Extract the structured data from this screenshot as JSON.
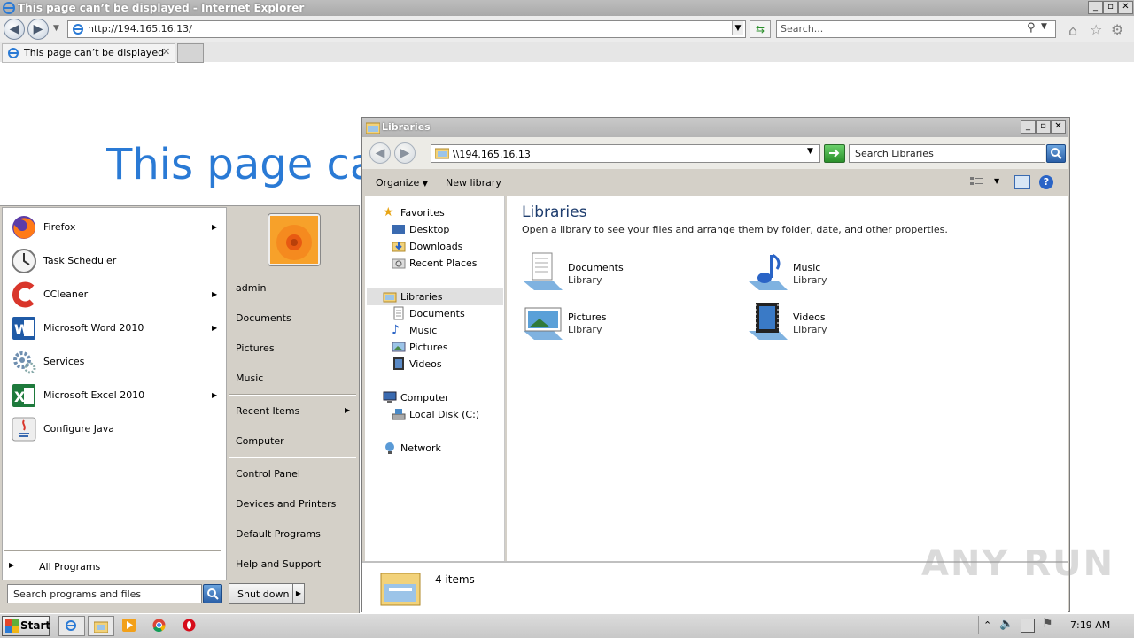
{
  "ie": {
    "window_title": "This page can’t be displayed - Internet Explorer",
    "url": "http://194.165.16.13/",
    "search_placeholder": "Search...",
    "tab_title": "This page can’t be displayed",
    "page_heading": "This page can’t be displayed"
  },
  "start_menu": {
    "programs": [
      {
        "label": "Firefox",
        "icon": "firefox-icon",
        "has_submenu": true
      },
      {
        "label": "Task Scheduler",
        "icon": "task-scheduler-icon",
        "has_submenu": false
      },
      {
        "label": "CCleaner",
        "icon": "ccleaner-icon",
        "has_submenu": true
      },
      {
        "label": "Microsoft Word 2010",
        "icon": "word-icon",
        "has_submenu": true
      },
      {
        "label": "Services",
        "icon": "services-icon",
        "has_submenu": false
      },
      {
        "label": "Microsoft Excel 2010",
        "icon": "excel-icon",
        "has_submenu": true
      },
      {
        "label": "Configure Java",
        "icon": "java-icon",
        "has_submenu": false
      }
    ],
    "all_programs": "All Programs",
    "search_placeholder": "Search programs and files",
    "right_links": [
      "admin",
      "Documents",
      "Pictures",
      "Music",
      "Recent Items",
      "Computer",
      "Control Panel",
      "Devices and Printers",
      "Default Programs",
      "Help and Support"
    ],
    "shutdown_label": "Shut down"
  },
  "explorer": {
    "window_title": "Libraries",
    "address": "\\\\194.165.16.13",
    "search_placeholder": "Search Libraries",
    "organize_label": "Organize",
    "new_library_label": "New library",
    "nav": {
      "favorites": "Favorites",
      "desktop": "Desktop",
      "downloads": "Downloads",
      "recent_places": "Recent Places",
      "libraries": "Libraries",
      "documents": "Documents",
      "music": "Music",
      "pictures": "Pictures",
      "videos": "Videos",
      "computer": "Computer",
      "local_disk": "Local Disk (C:)",
      "network": "Network"
    },
    "heading": "Libraries",
    "description": "Open a library to see your files and arrange them by folder, date, and other properties.",
    "libraries": [
      {
        "name": "Documents",
        "sub": "Library"
      },
      {
        "name": "Music",
        "sub": "Library"
      },
      {
        "name": "Pictures",
        "sub": "Library"
      },
      {
        "name": "Videos",
        "sub": "Library"
      }
    ],
    "item_count": "4 items"
  },
  "taskbar": {
    "start_label": "Start",
    "clock": "7:19 AM"
  },
  "watermark": "ANY RUN"
}
